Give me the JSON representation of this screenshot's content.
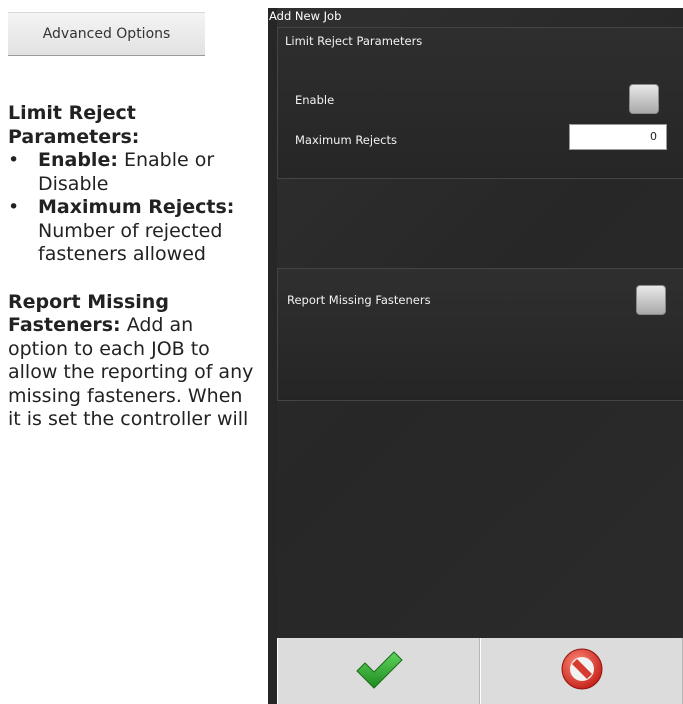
{
  "advanced_options_button": "Advanced Options",
  "doc": {
    "limit_heading": "Limit Reject Parameters:",
    "items": [
      {
        "bullet": "•",
        "term": "Enable:",
        "desc": " Enable or Disable"
      },
      {
        "bullet": "•",
        "term": "Maximum Rejects:",
        "desc": " Number of rejected fasteners allowed"
      }
    ],
    "report_term": "Report Missing Fasteners:",
    "report_desc": " Add an option to each JOB to allow the reporting of any missing fasteners. When it is set the controller will"
  },
  "screen": {
    "title": "Add New Job",
    "limit_panel": {
      "legend": "Limit Reject Parameters",
      "enable_label": "Enable",
      "enable_checked": false,
      "max_rejects_label": "Maximum Rejects",
      "max_rejects_value": "0"
    },
    "report_panel": {
      "label": "Report Missing Fasteners",
      "checked": false
    },
    "buttons": {
      "ok_icon": "green-checkmark-icon",
      "cancel_icon": "red-prohibited-icon"
    }
  },
  "colors": {
    "screen_bg": "#2b2b2b",
    "checkmark": "#2e9e2e",
    "cancel": "#d6332a"
  }
}
